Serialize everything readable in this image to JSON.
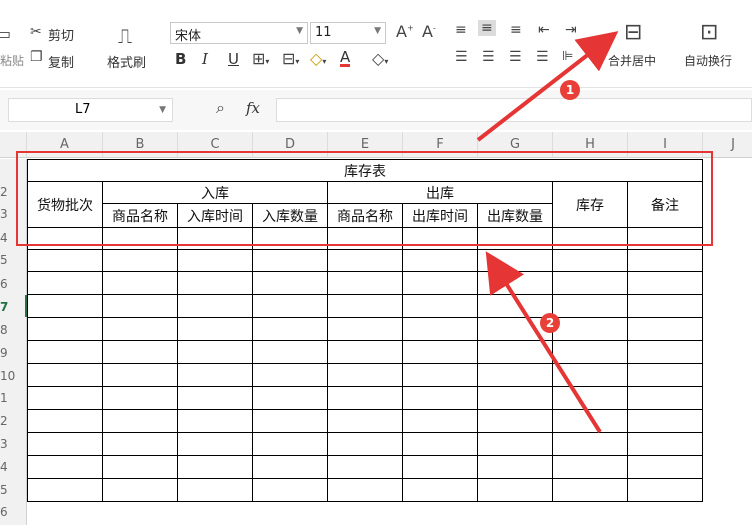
{
  "ribbon": {
    "paste_label": "粘贴",
    "cut_label": "剪切",
    "copy_label": "复制",
    "format_painter_label": "格式刷",
    "font_name": "宋体",
    "font_size": "11",
    "bold": "B",
    "italic": "I",
    "underline": "U",
    "font_color_letter": "A",
    "merge_center_label": "合并居中",
    "wrap_text_label": "自动换行"
  },
  "formula_bar": {
    "cell_ref": "L7",
    "fx": "fx"
  },
  "columns": [
    "A",
    "B",
    "C",
    "D",
    "E",
    "F",
    "G",
    "H",
    "I",
    "J"
  ],
  "rows": [
    "2",
    "3",
    "4",
    "5",
    "6",
    "7",
    "8",
    "9",
    "10",
    "1",
    "2",
    "3",
    "4",
    "5",
    "6"
  ],
  "table": {
    "title": "库存表",
    "batch": "货物批次",
    "inbound": "入库",
    "outbound": "出库",
    "stock": "库存",
    "note": "备注",
    "in_subheaders": [
      "商品名称",
      "入库时间",
      "入库数量"
    ],
    "out_subheaders": [
      "商品名称",
      "出库时间",
      "出库数量"
    ]
  },
  "annotations": {
    "badge1": "1",
    "badge2": "2",
    "accent": "#e53535"
  }
}
